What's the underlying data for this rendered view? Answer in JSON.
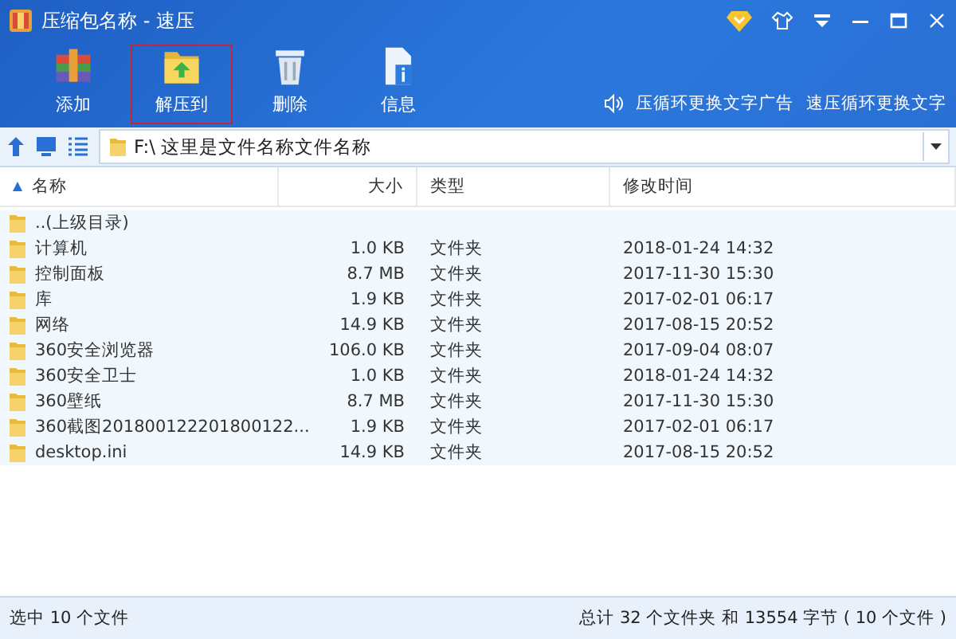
{
  "window": {
    "title": "压缩包名称 - 速压"
  },
  "toolbar": [
    {
      "label": "添加",
      "kind": "add",
      "highlighted": false
    },
    {
      "label": "解压到",
      "kind": "extract",
      "highlighted": true
    },
    {
      "label": "删除",
      "kind": "delete",
      "highlighted": false
    },
    {
      "label": "信息",
      "kind": "info",
      "highlighted": false
    }
  ],
  "ads": [
    "压循环更换文字广告",
    "速压循环更换文字"
  ],
  "path": "F:\\ 这里是文件名称文件名称",
  "table": {
    "columns": [
      "名称",
      "大小",
      "类型",
      "修改时间"
    ],
    "rows": [
      {
        "name": "..(上级目录)",
        "size": "",
        "type": "",
        "modified": "",
        "kind": "folder",
        "selected": true
      },
      {
        "name": "计算机",
        "size": "1.0 KB",
        "type": "文件夹",
        "modified": "2018-01-24 14:32",
        "kind": "folder",
        "selected": true
      },
      {
        "name": "控制面板",
        "size": "8.7 MB",
        "type": "文件夹",
        "modified": "2017-11-30 15:30",
        "kind": "folder",
        "selected": true
      },
      {
        "name": "库",
        "size": "1.9 KB",
        "type": "文件夹",
        "modified": "2017-02-01 06:17",
        "kind": "folder",
        "selected": true
      },
      {
        "name": "网络",
        "size": "14.9 KB",
        "type": "文件夹",
        "modified": "2017-08-15 20:52",
        "kind": "folder",
        "selected": true
      },
      {
        "name": "360安全浏览器",
        "size": "106.0 KB",
        "type": "文件夹",
        "modified": "2017-09-04 08:07",
        "kind": "folder",
        "selected": true
      },
      {
        "name": "360安全卫士",
        "size": "1.0 KB",
        "type": "文件夹",
        "modified": "2018-01-24 14:32",
        "kind": "folder",
        "selected": true
      },
      {
        "name": "360壁纸",
        "size": "8.7 MB",
        "type": "文件夹",
        "modified": "2017-11-30 15:30",
        "kind": "folder",
        "selected": true
      },
      {
        "name": "360截图20180012220180012​2...",
        "size": "1.9 KB",
        "type": "文件夹",
        "modified": "2017-02-01 06:17",
        "kind": "folder",
        "selected": true
      },
      {
        "name": "desktop.ini",
        "size": "14.9 KB",
        "type": "文件夹",
        "modified": "2017-08-15 20:52",
        "kind": "folder",
        "selected": true
      }
    ]
  },
  "status_bar": {
    "left": "选中 10 个文件",
    "right": "总计 32 个文件夹 和 13554 字节 ( 10 个文件 )"
  }
}
